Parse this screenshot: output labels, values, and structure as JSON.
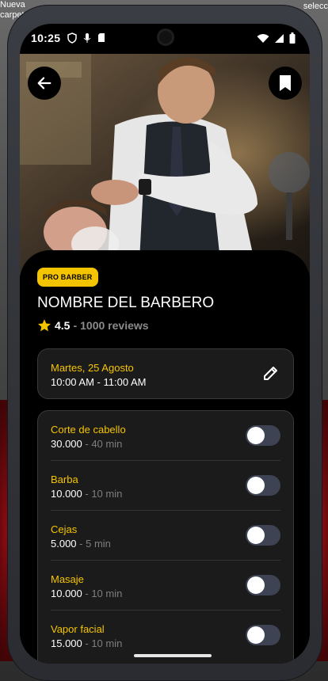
{
  "desktop": {
    "left_label": "Nueva carpeta",
    "right_label": "selecc"
  },
  "status_bar": {
    "time": "10:25"
  },
  "hero": {
    "back_icon": "arrow-left-icon",
    "bookmark_icon": "bookmark-icon"
  },
  "barber": {
    "badge": "PRO BARBER",
    "name": "NOMBRE DEL BARBERO",
    "rating": "4.5",
    "separator": "-",
    "reviews": "1000 reviews"
  },
  "appointment": {
    "date": "Martes, 25 Agosto",
    "time": "10:00 AM - 11:00 AM",
    "edit_icon": "pencil-icon"
  },
  "services": [
    {
      "name": "Corte de cabello",
      "price": "30.000",
      "duration": " - 40 min",
      "enabled": false
    },
    {
      "name": "Barba",
      "price": "10.000",
      "duration": " - 10 min",
      "enabled": false
    },
    {
      "name": "Cejas",
      "price": "5.000",
      "duration": " - 5 min",
      "enabled": false
    },
    {
      "name": "Masaje",
      "price": "10.000",
      "duration": " - 10 min",
      "enabled": false
    },
    {
      "name": "Vapor facial",
      "price": "15.000",
      "duration": " - 10 min",
      "enabled": false
    }
  ],
  "colors": {
    "accent": "#f5c400",
    "card_bg": "#1b1b1b",
    "toggle_off": "#3d4352"
  }
}
